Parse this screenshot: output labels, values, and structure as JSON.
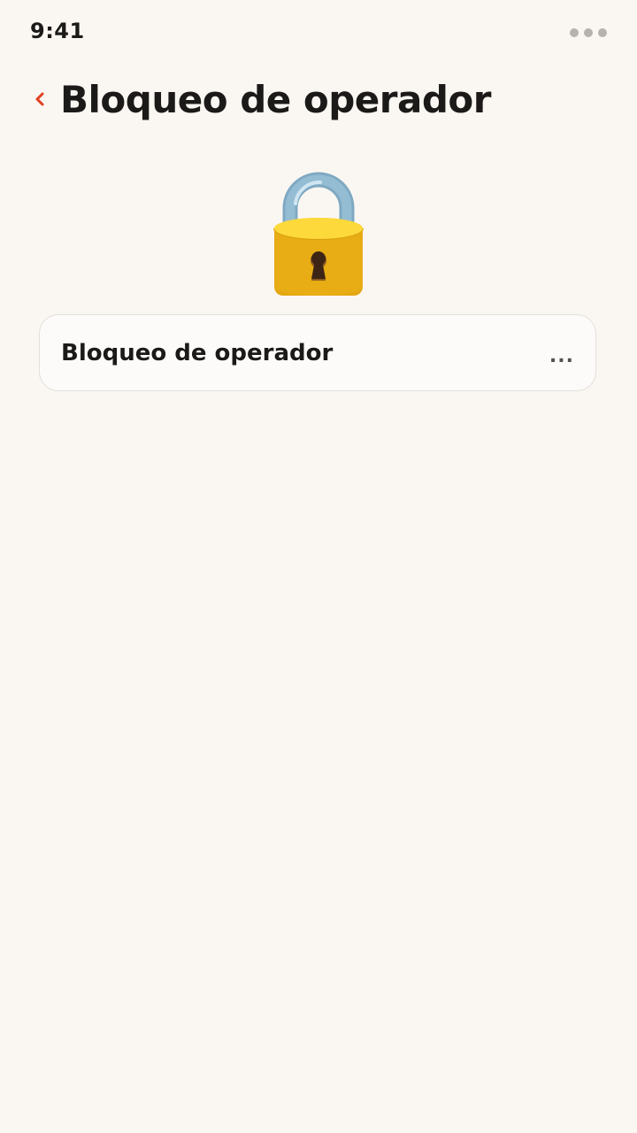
{
  "status_bar": {
    "time": "9:41"
  },
  "header": {
    "title": "Bloqueo de operador",
    "back_icon": "chevron-left-icon",
    "back_color": "#e2401f"
  },
  "hero": {
    "icon": "padlock-icon"
  },
  "settings": {
    "items": [
      {
        "label": "Bloqueo de operador",
        "value": "..."
      }
    ]
  },
  "colors": {
    "background": "#faf7f3",
    "text": "#1c1a18",
    "accent": "#e2401f"
  }
}
